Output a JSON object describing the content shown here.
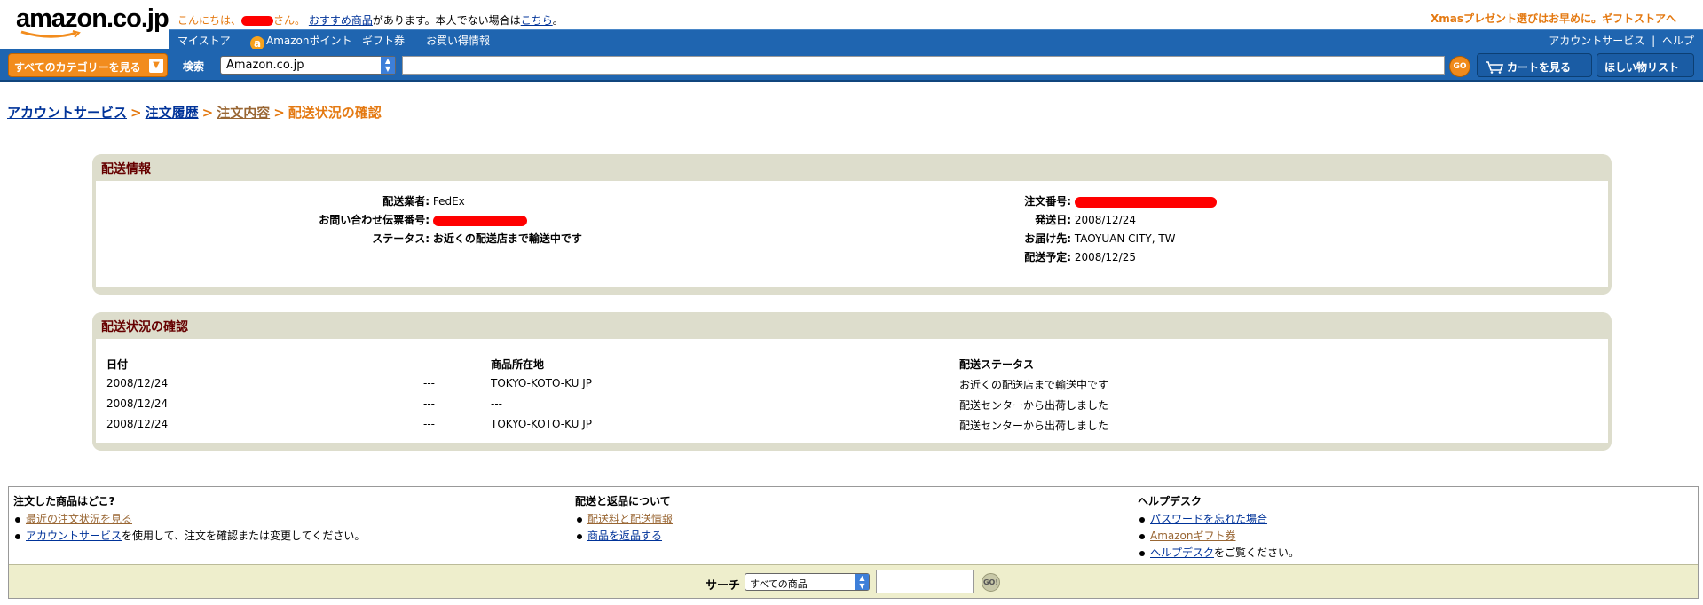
{
  "header": {
    "logo": "amazon.co.jp",
    "greeting": {
      "hello": "こんにちは、",
      "san": "さん。",
      "recommend_link": "おすすめ商品",
      "middle": "があります。本人でない場合は",
      "here_link": "こちら",
      "end": "。"
    },
    "promo": "Xmasプレゼント選びはお早めに。ギフトストアへ"
  },
  "nav": {
    "items": [
      "マイストア",
      "Amazonポイント",
      "ギフト券",
      "お買い得情報"
    ],
    "points_icon": "a",
    "account": "アカウントサービス",
    "sep": "|",
    "help": "ヘルプ"
  },
  "search": {
    "category_button": "すべてのカテゴリーを見る",
    "label": "検索",
    "select_value": "Amazon.co.jp",
    "input_value": "",
    "go": "GO",
    "cart": "カートを見る",
    "wishlist": "ほしい物リスト"
  },
  "breadcrumb": {
    "items": [
      "アカウントサービス",
      "注文履歴",
      "注文内容"
    ],
    "current": "配送状況の確認",
    "separator": ">"
  },
  "shipping_info": {
    "title": "配送情報",
    "carrier_label": "配送業者:",
    "carrier_value": "FedEx",
    "tracking_label": "お問い合わせ伝票番号:",
    "status_label": "ステータス:",
    "status_value": "お近くの配送店まで輸送中です",
    "order_label": "注文番号:",
    "ship_date_label": "発送日:",
    "ship_date_value": "2008/12/24",
    "destination_label": "お届け先:",
    "destination_value": "TAOYUAN CITY, TW",
    "eta_label": "配送予定:",
    "eta_value": "2008/12/25"
  },
  "tracking": {
    "title": "配送状況の確認",
    "columns": {
      "date": "日付",
      "location": "商品所在地",
      "status": "配送ステータス"
    },
    "rows": [
      {
        "date": "2008/12/24",
        "dash": "---",
        "location": "TOKYO-KOTO-KU JP",
        "status": "お近くの配送店まで輸送中です"
      },
      {
        "date": "2008/12/24",
        "dash": "---",
        "location": "---",
        "status": "配送センターから出荷しました"
      },
      {
        "date": "2008/12/24",
        "dash": "---",
        "location": "TOKYO-KOTO-KU JP",
        "status": "配送センターから出荷しました"
      }
    ]
  },
  "footer": {
    "col1": {
      "title": "注文した商品はどこ?",
      "link1": "最近の注文状況を見る",
      "link2": "アカウントサービス",
      "text2": "を使用して、注文を確認または変更してください。"
    },
    "col2": {
      "title": "配送と返品について",
      "link1": "配送料と配送情報",
      "link2": "商品を返品する"
    },
    "col3": {
      "title": "ヘルプデスク",
      "link1": "パスワードを忘れた場合",
      "link2": "Amazonギフト券",
      "link3": "ヘルプデスク",
      "text3": "をご覧ください。"
    },
    "search": {
      "label": "サーチ",
      "select_value": "すべての商品",
      "input_value": "",
      "go": "GO!"
    }
  },
  "colors": {
    "nav_blue": "#1f65b0",
    "orange": "#e47911",
    "panel_bg": "#ddddcc",
    "panel_title": "#660000",
    "redaction": "#ff0000"
  }
}
